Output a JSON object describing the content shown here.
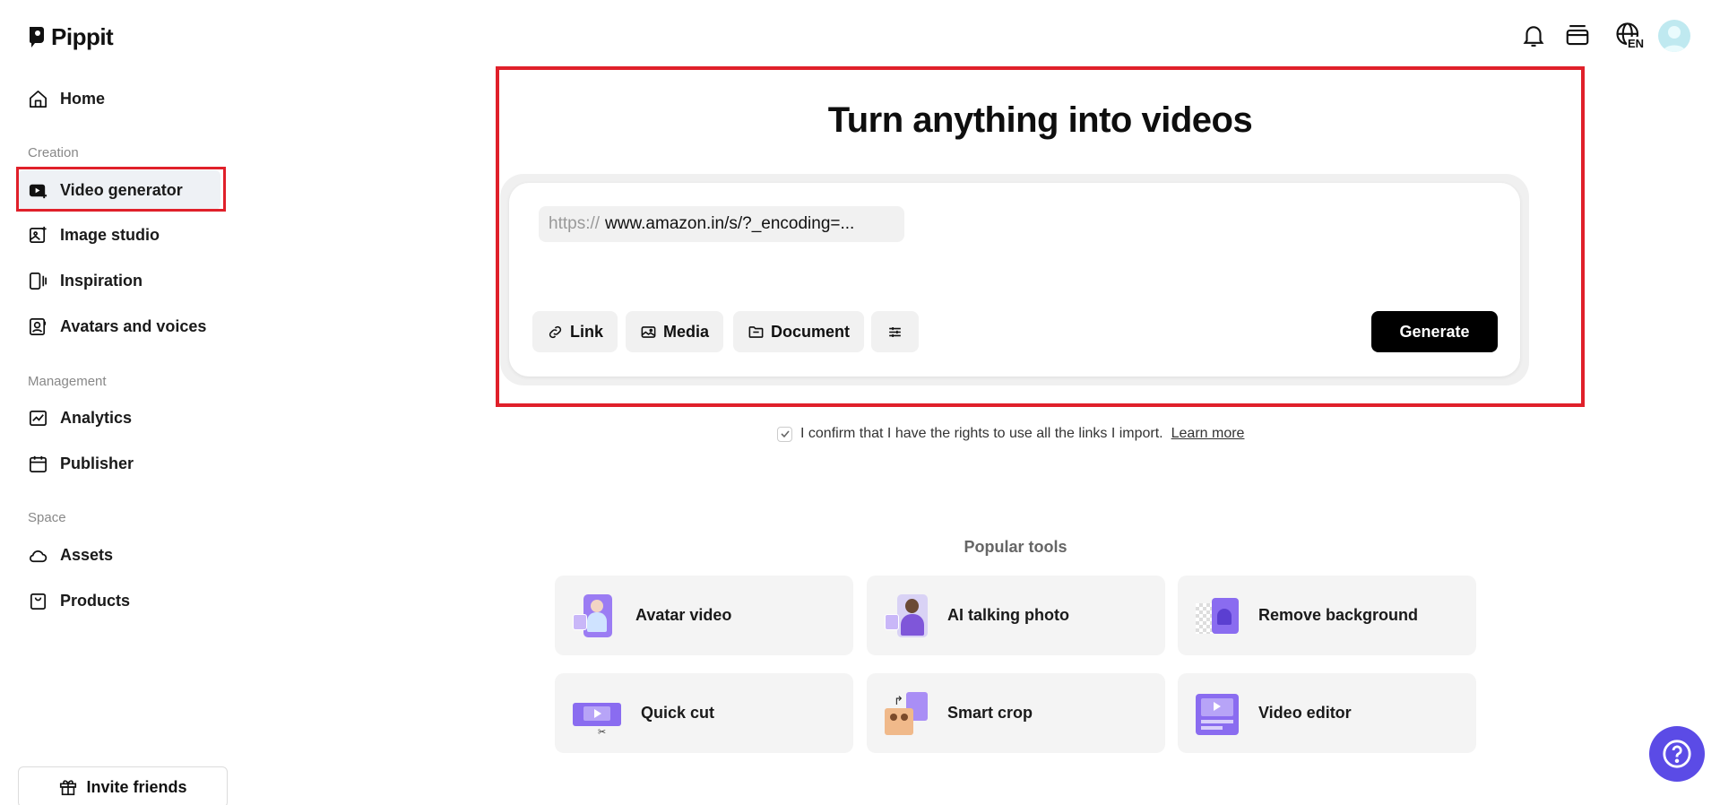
{
  "app": {
    "name": "Pippit"
  },
  "sidebar": {
    "home": "Home",
    "sections": {
      "creation": "Creation",
      "management": "Management",
      "space": "Space"
    },
    "creation_items": [
      "Video generator",
      "Image studio",
      "Inspiration",
      "Avatars and voices"
    ],
    "management_items": [
      "Analytics",
      "Publisher"
    ],
    "space_items": [
      "Assets",
      "Products"
    ],
    "active_item": "Video generator",
    "invite": "Invite friends"
  },
  "topbar": {
    "icons": [
      "bell-icon",
      "credits-icon",
      "language-globe-icon",
      "user-avatar"
    ],
    "language_code": "EN"
  },
  "hero": {
    "title": "Turn anything into videos",
    "url_prefix": "https://",
    "url_value": "www.amazon.in/s/?_encoding=...",
    "chips": [
      "Link",
      "Media",
      "Document"
    ],
    "generate": "Generate",
    "confirm_text": "I confirm that I have the rights to use all the links I import.",
    "learn_more": "Learn more"
  },
  "popular": {
    "title": "Popular tools",
    "tools": [
      "Avatar video",
      "AI talking photo",
      "Remove background",
      "Quick cut",
      "Smart crop",
      "Video editor"
    ]
  },
  "colors": {
    "accent_red": "#e0202a",
    "primary": "#000000",
    "help": "#5b4be6",
    "tool_purple": "#8a6cf0"
  }
}
